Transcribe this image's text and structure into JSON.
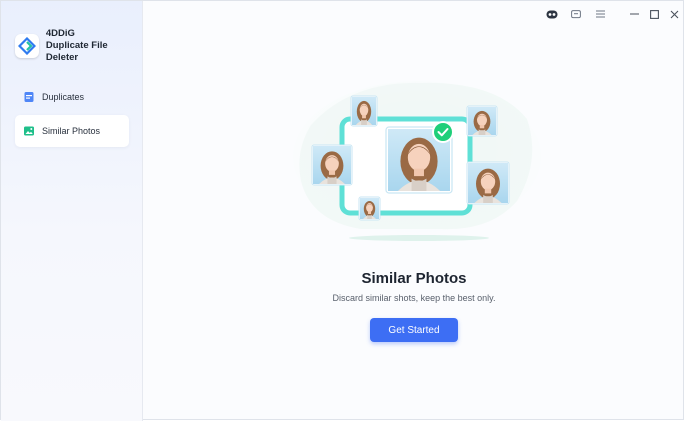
{
  "app": {
    "name_line1": "4DDiG",
    "name_line2": "Duplicate File Deleter"
  },
  "sidebar": {
    "items": [
      {
        "label": "Duplicates",
        "icon": "file-stack-icon",
        "active": false
      },
      {
        "label": "Similar Photos",
        "icon": "photo-icon",
        "active": true
      }
    ]
  },
  "window_controls": {
    "icons": [
      "account-icon",
      "feedback-icon",
      "menu-icon",
      "minimize-icon",
      "maximize-icon",
      "close-icon"
    ]
  },
  "main": {
    "title": "Similar Photos",
    "subtitle": "Discard similar shots, keep the best only.",
    "button_label": "Get Started"
  },
  "colors": {
    "accent": "#3d6ef4",
    "teal_frame": "#5fe0d6",
    "check_green": "#1fcf7a"
  }
}
